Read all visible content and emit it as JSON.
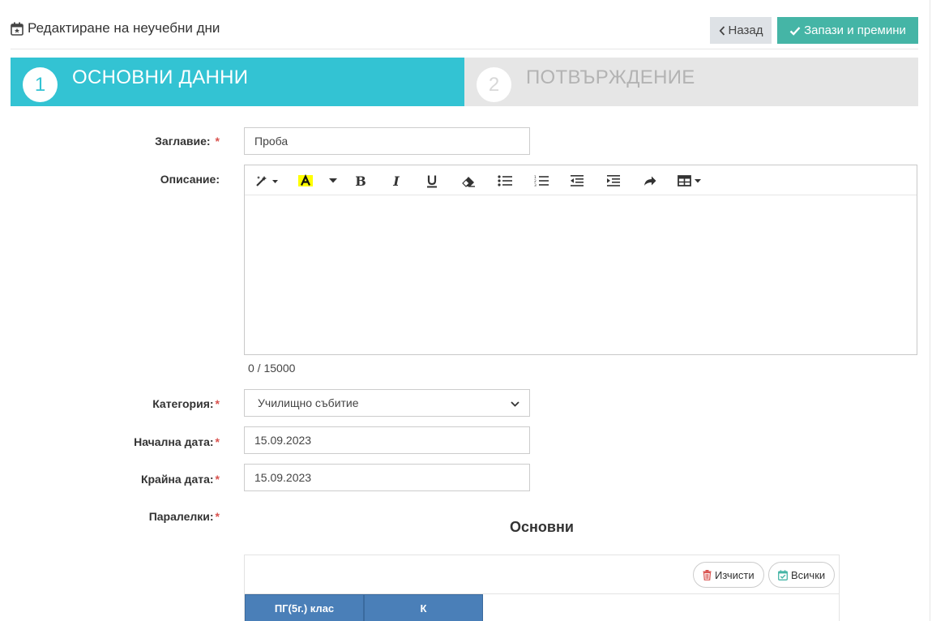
{
  "header": {
    "title": "Редактиране на неучебни дни",
    "back_label": "Назад",
    "save_label": "Запази и премини"
  },
  "steps": [
    {
      "number": "1",
      "label": "ОСНОВНИ ДАННИ",
      "active": true
    },
    {
      "number": "2",
      "label": "ПОТВЪРЖДЕНИЕ",
      "active": false
    }
  ],
  "form": {
    "title_label": "Заглавие:",
    "title_value": "Проба",
    "description_label": "Описание:",
    "description_counter": "0 / 15000",
    "category_label": "Категория:",
    "category_value": "Училищно събитие",
    "start_date_label": "Начална дата:",
    "start_date_value": "15.09.2023",
    "end_date_label": "Крайна дата:",
    "end_date_value": "15.09.2023",
    "classes_label": "Паралелки:",
    "required_mark": "*"
  },
  "classes": {
    "section_title": "Основни",
    "clear_label": "Изчисти",
    "all_label": "Всички",
    "items": [
      "ПГ(5г.) клас",
      "К"
    ]
  },
  "colors": {
    "accent": "#33c3d3",
    "save": "#45b5a6",
    "class_chip": "#4a7fb8",
    "required": "#d9534f"
  }
}
